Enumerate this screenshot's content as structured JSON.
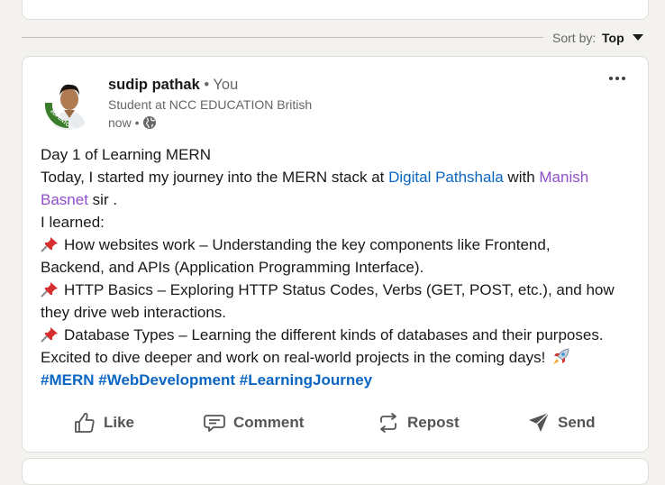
{
  "sort": {
    "label": "Sort by:",
    "value": "Top"
  },
  "post": {
    "author": {
      "name": "sudip pathak",
      "you_badge": "• You",
      "headline": "Student at NCC EDUCATION British",
      "time": "now •",
      "avatar_badge": "#OPENTOWORK"
    },
    "lines": {
      "l1": "Day 1 of Learning MERN",
      "l2_pre": "Today, I started my journey into the MERN stack at ",
      "l2_link1": "Digital Pathshala",
      "l2_mid": " with ",
      "l2_link2a": "Manish",
      "l3_link2b": "Basnet",
      "l3_post": " sir .",
      "l4": "I learned:",
      "l5": "How websites work – Understanding the key components like Frontend,",
      "l6": "Backend, and APIs (Application Programming Interface).",
      "l7": "HTTP Basics – Exploring HTTP Status Codes, Verbs (GET, POST, etc.), and how",
      "l8": "they drive web interactions.",
      "l9": "Database Types – Learning the different kinds of databases and their purposes.",
      "l10": "Excited to dive deeper and work on real-world projects in the coming days!",
      "tag1": "#MERN",
      "tag2": "#WebDevelopment",
      "tag3": "#LearningJourney"
    },
    "actions": {
      "like": "Like",
      "comment": "Comment",
      "repost": "Repost",
      "send": "Send"
    }
  },
  "colors": {
    "link_blue": "#0a66c2",
    "mention_purple": "#8f4ecc",
    "opentowork_green": "#3b7d2a",
    "background": "#f4f2ee"
  },
  "icons": {
    "like": "thumbs-up-icon",
    "comment": "comment-icon",
    "repost": "repost-icon",
    "send": "send-icon",
    "more": "more-horizontal-icon",
    "visibility": "globe-icon",
    "bullet": "pushpin-icon",
    "rocket": "rocket-icon"
  }
}
